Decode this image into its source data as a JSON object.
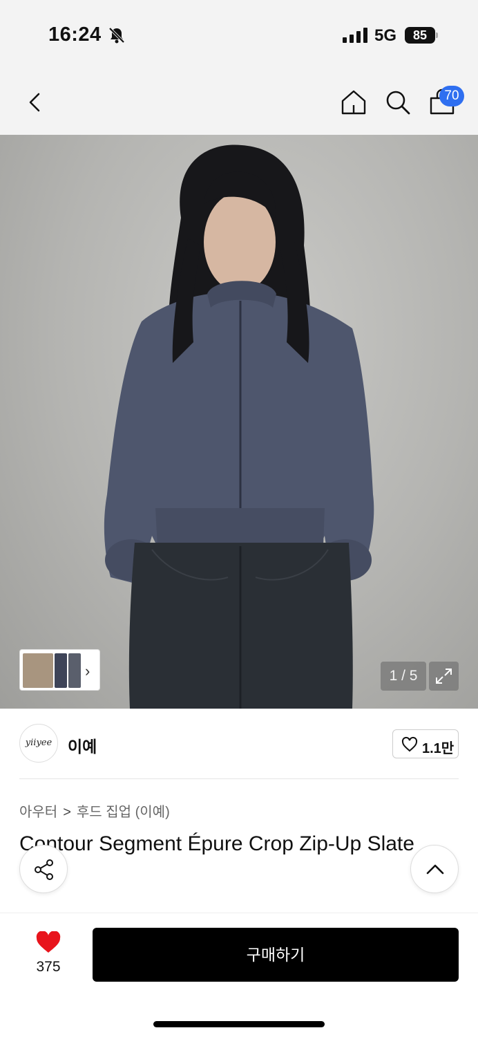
{
  "status": {
    "time": "16:24",
    "network": "5G",
    "battery": "85"
  },
  "nav": {
    "cart_count": "70"
  },
  "gallery": {
    "counter": "1 / 5"
  },
  "brand": {
    "logo_text": "yiiyee",
    "name": "이예",
    "like_count": "1.1만"
  },
  "breadcrumb": {
    "category": "아우터",
    "separator": ">",
    "subcategory": "후드 집업 (이예)"
  },
  "product": {
    "title": "Contour Segment Épure Crop Zip-Up Slate"
  },
  "bottom": {
    "wish_count": "375",
    "buy_label": "구매하기"
  },
  "colors": {
    "accent_badge": "#2f6ff0",
    "wish_heart": "#e8141c",
    "buy_button": "#000000"
  },
  "icons": [
    "back-icon",
    "home-icon",
    "search-icon",
    "bag-icon",
    "expand-icon",
    "heart-outline-icon",
    "share-icon",
    "chevron-up-icon",
    "heart-filled-icon"
  ]
}
